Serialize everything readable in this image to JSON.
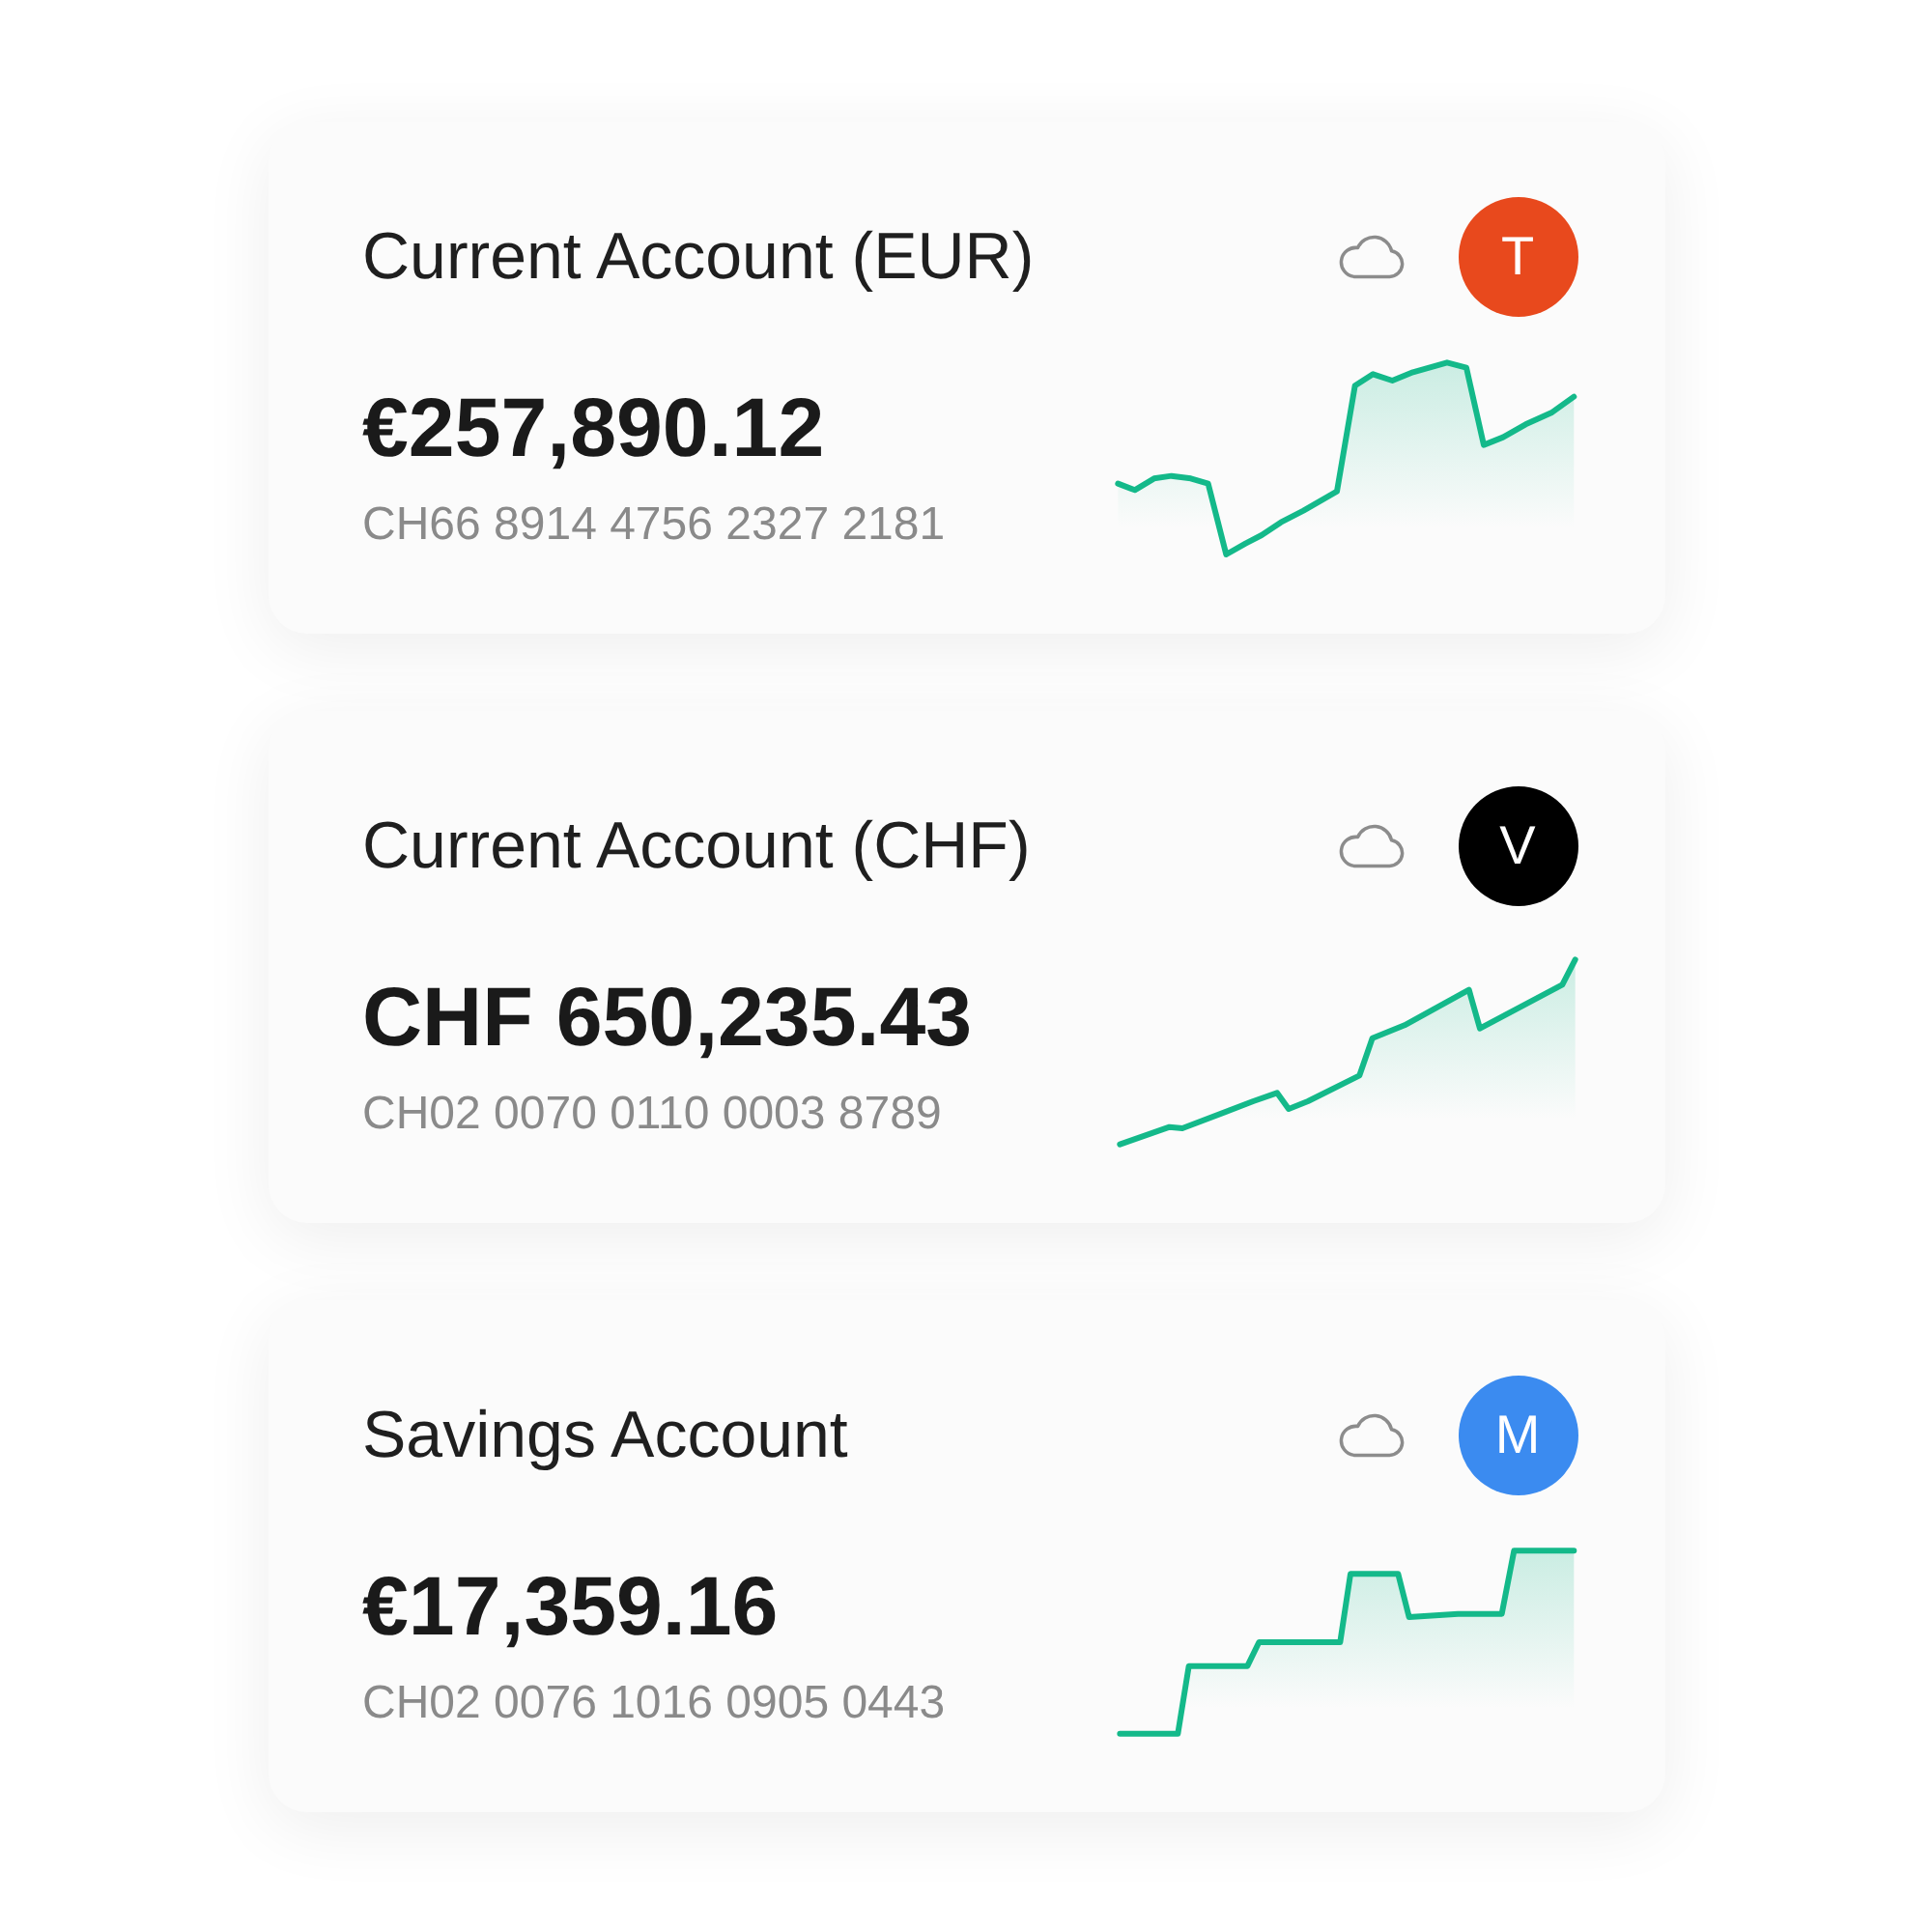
{
  "accounts": [
    {
      "name": "Current Account (EUR)",
      "balance": "€257,890.12",
      "iban": "CH66 8914 4756 2327 2181",
      "avatar_letter": "T",
      "color": "#e8491d"
    },
    {
      "name": "Current Account (CHF)",
      "balance": "CHF 650,235.43",
      "iban": "CH02 0070 0110 0003 8789",
      "avatar_letter": "V",
      "color": "#000000"
    },
    {
      "name": "Savings Account",
      "balance": "€17,359.16",
      "iban": "CH02 0076 1016 0905 0443",
      "avatar_letter": "M",
      "color": "#3b8bf0"
    }
  ]
}
